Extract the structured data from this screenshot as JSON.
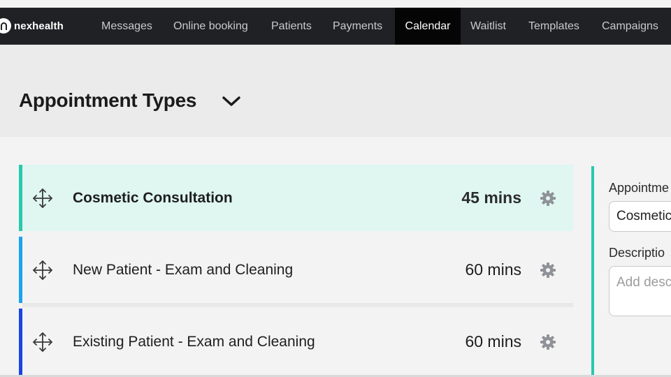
{
  "app": {
    "logo_text": "nexhealth"
  },
  "nav": {
    "items": [
      {
        "label": "Messages",
        "active": false
      },
      {
        "label": "Online booking",
        "active": false
      },
      {
        "label": "Patients",
        "active": false
      },
      {
        "label": "Payments",
        "active": false
      },
      {
        "label": "Calendar",
        "active": true
      },
      {
        "label": "Waitlist",
        "active": false
      },
      {
        "label": "Templates",
        "active": false
      },
      {
        "label": "Campaigns",
        "active": false
      }
    ]
  },
  "page": {
    "title": "Appointment Types"
  },
  "appointment_types": [
    {
      "name": "Cosmetic Consultation",
      "duration": "45 mins",
      "selected": true,
      "color": "#28c9ad"
    },
    {
      "name": "New Patient - Exam and Cleaning",
      "duration": "60 mins",
      "selected": false,
      "color": "#1aa3f0"
    },
    {
      "name": "Existing Patient - Exam and Cleaning",
      "duration": "60 mins",
      "selected": false,
      "color": "#1a44e6"
    }
  ],
  "detail": {
    "name_label": "Appointme",
    "name_value": "Cosmetic",
    "description_label": "Descriptio",
    "description_placeholder": "Add desc"
  },
  "icons": {
    "logo": "nexhealth-logo-icon",
    "title_toggle": "chevron-down-icon",
    "drag": "drag-handle-icon",
    "settings": "gear-icon"
  },
  "colors": {
    "nav_bg": "#1f2125",
    "nav_active_bg": "#050505",
    "accent": "#28c9ad",
    "selected_row_bg": "#dff6f1"
  }
}
